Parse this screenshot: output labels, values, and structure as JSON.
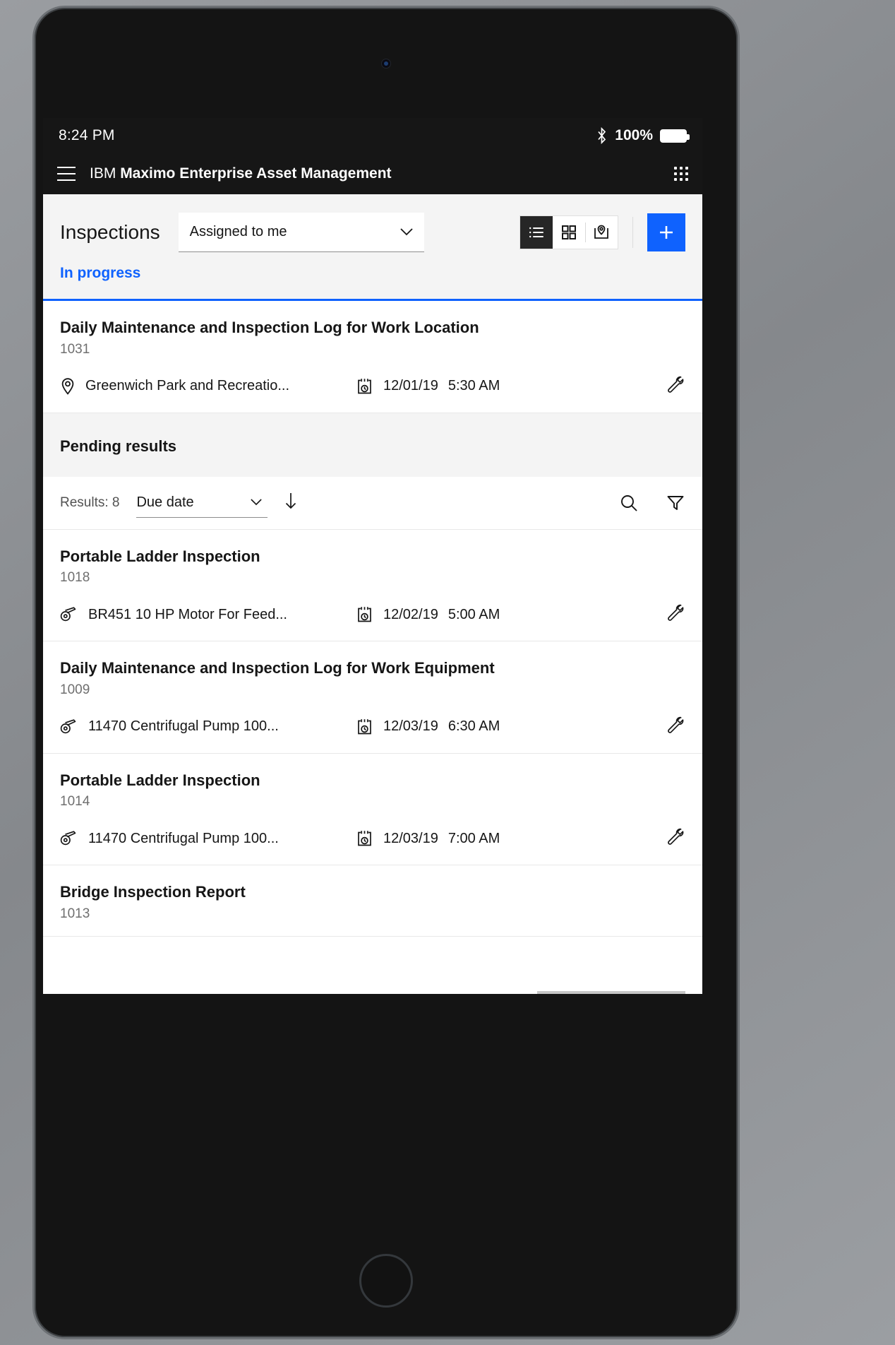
{
  "status_bar": {
    "time": "8:24 PM",
    "battery_percent": "100%",
    "bluetooth_icon": "bluetooth-icon",
    "battery_icon": "battery-full-icon"
  },
  "app_bar": {
    "menu_icon": "hamburger-menu-icon",
    "brand": "IBM",
    "product": "Maximo Enterprise Asset Management",
    "apps_icon": "app-switcher-grid-icon"
  },
  "header": {
    "title": "Inspections",
    "filter_select": {
      "value": "Assigned to me",
      "chevron_icon": "chevron-down-icon"
    },
    "view_toggle": [
      {
        "name": "list-view",
        "icon": "list-icon",
        "active": true
      },
      {
        "name": "grid-view",
        "icon": "grid-icon",
        "active": false
      },
      {
        "name": "map-view",
        "icon": "map-pin-icon",
        "active": false
      }
    ],
    "add_button": {
      "label": "+",
      "icon": "plus-icon",
      "color": "#0f62fe"
    }
  },
  "tabs": {
    "in_progress": "In progress",
    "accent_color": "#0f62fe"
  },
  "in_progress_items": [
    {
      "title": "Daily Maintenance and Inspection Log for Work Location",
      "id": "1031",
      "meta_icon": "location-pin-icon",
      "meta_text": "Greenwich Park and Recreatio...",
      "date_icon": "calendar-clock-icon",
      "date": "12/01/19",
      "time": "5:30 AM",
      "action_icon": "wrench-icon"
    }
  ],
  "pending": {
    "heading": "Pending results",
    "results_label": "Results: 8",
    "sort_value": "Due date",
    "sort_chevron_icon": "chevron-down-icon",
    "sort_direction_icon": "arrow-down-icon",
    "search_icon": "search-icon",
    "filter_icon": "filter-funnel-icon"
  },
  "pending_items": [
    {
      "title": "Portable Ladder Inspection",
      "id": "1018",
      "meta_icon": "asset-belt-icon",
      "meta_text": "BR451 10 HP Motor For Feed...",
      "date_icon": "calendar-clock-icon",
      "date": "12/02/19",
      "time": "5:00 AM",
      "action_icon": "wrench-icon"
    },
    {
      "title": "Daily Maintenance and Inspection Log for Work Equipment",
      "id": "1009",
      "meta_icon": "asset-belt-icon",
      "meta_text": "11470 Centrifugal Pump 100...",
      "date_icon": "calendar-clock-icon",
      "date": "12/03/19",
      "time": "6:30 AM",
      "action_icon": "wrench-icon"
    },
    {
      "title": "Portable Ladder Inspection",
      "id": "1014",
      "meta_icon": "asset-belt-icon",
      "meta_text": "11470 Centrifugal Pump 100...",
      "date_icon": "calendar-clock-icon",
      "date": "12/03/19",
      "time": "7:00 AM",
      "action_icon": "wrench-icon"
    },
    {
      "title": "Bridge Inspection Report",
      "id": "1013",
      "meta_icon": "",
      "meta_text": "",
      "date_icon": "",
      "date": "",
      "time": "",
      "action_icon": ""
    }
  ]
}
